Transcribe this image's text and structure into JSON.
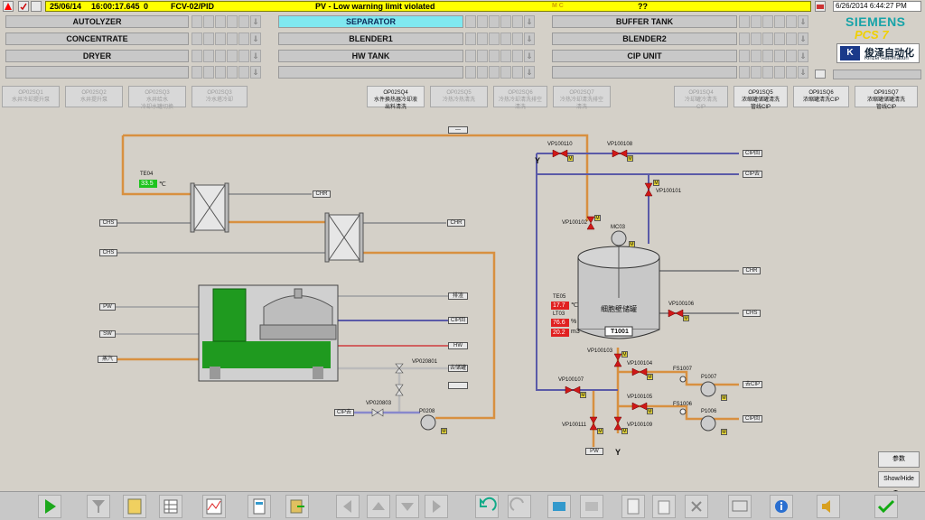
{
  "header": {
    "alarm": {
      "date": "25/06/14",
      "time": "16:00:17.645",
      "code": "0",
      "source": "FCV-02/PID",
      "message": "PV - Low warning limit violated",
      "state": "?? "
    },
    "datetime": "6/26/2014 6:44:27 PM"
  },
  "areas": {
    "row1": [
      "AUTOLYZER",
      "SEPARATOR",
      "BUFFER TANK"
    ],
    "row2": [
      "CONCENTRATE",
      "BLENDER1",
      "BLENDER2"
    ],
    "row3": [
      "DRYER",
      "HW TANK",
      "CIP UNIT"
    ],
    "active": "SEPARATOR"
  },
  "brand": {
    "siemens": "SIEMENS",
    "pcs7": "PCS 7",
    "kinzer_cn": "俊泽自动化",
    "kinzer_en": "Kinzer Automation",
    "kinzer_logo": "K"
  },
  "faceplates": [
    {
      "l1": "OP02SQ1",
      "l2": "水井冷却提升泵",
      "on": false
    },
    {
      "l1": "OP02SQ2",
      "l2": "水井提升泵",
      "on": false
    },
    {
      "l1": "OP02SQ3",
      "l2": "水井给水",
      "l3": "冷却水罐切换",
      "on": false
    },
    {
      "l1": "OP02SQ3",
      "l2": "冷水塔冷却",
      "on": false
    },
    {
      "l1": "OP02SQ4",
      "l2": "水件换热器冷却液",
      "l3": "出料清洗",
      "on": true
    },
    {
      "l1": "OP02SQ5",
      "l2": "冷热冷热清洗",
      "on": false
    },
    {
      "l1": "OP02SQ6",
      "l2": "冷热冷却清洗排空",
      "l3": "清洗",
      "on": false
    },
    {
      "l1": "OP02SQ7",
      "l2": "冷热冷却清洗排空",
      "l3": "清洗",
      "on": false
    },
    {
      "l1": "OP91SQ4",
      "l2": "冷却罐冷清洗",
      "l3": "CIP",
      "on": false
    },
    {
      "l1": "OP91SQ5",
      "l2": "浓缩罐储罐清洗",
      "l3": "管线CIP",
      "on": true
    },
    {
      "l1": "OP91SQ6",
      "l2": "浓缩罐清洗CIP",
      "on": true
    },
    {
      "l1": "OP91SQ7",
      "l2": "浓缩罐储罐清洗",
      "l3": "管线CIP",
      "on": true
    }
  ],
  "plant": {
    "te04_label": "TE04",
    "te04_value": "33.5",
    "te04_unit": "℃",
    "chr": "CHR",
    "chs": "CHS",
    "pw": "PW",
    "sw": "SW",
    "hw": "HW",
    "cip_r": "CIP回",
    "cip_s": "CIP去",
    "steam": "蒸汽",
    "drain": "排渣",
    "to_tank": "去储罐",
    "dash": "—",
    "vp020801": "VP020801",
    "vp020803": "VP020803",
    "p0208": "P0208",
    "vp100110": "VP100110",
    "vp100108": "VP100108",
    "vp100101": "VP100101",
    "vp100102": "VP100102",
    "vp100106": "VP100106",
    "vp100103": "VP100103",
    "vp100104": "VP100104",
    "vp100105": "VP100105",
    "vp100107": "VP100107",
    "vp100109": "VP100109",
    "vp100111": "VP100111",
    "fs1007": "FS1007",
    "fs1006": "FS1006",
    "p1007": "P1007",
    "p1006": "P1006",
    "mc03": "MC03",
    "tank_name": "T1001",
    "tank_cn": "细胞壁储罐",
    "te05_label": "TE05",
    "te05_value": "17.7",
    "te05_unit": "℃",
    "lt03_label": "LT03",
    "lt03_pct": "76.6",
    "lt03_pct_unit": "%",
    "lt03_vol": "20.2",
    "lt03_vol_unit": "m3",
    "m": "M",
    "y": "Y",
    "pw_out": "PW",
    "to_cip": "去CIP",
    "cip_out": "CIP回"
  },
  "right_buttons": {
    "ref": "参数",
    "showhide": "Show/Hide Tag"
  }
}
